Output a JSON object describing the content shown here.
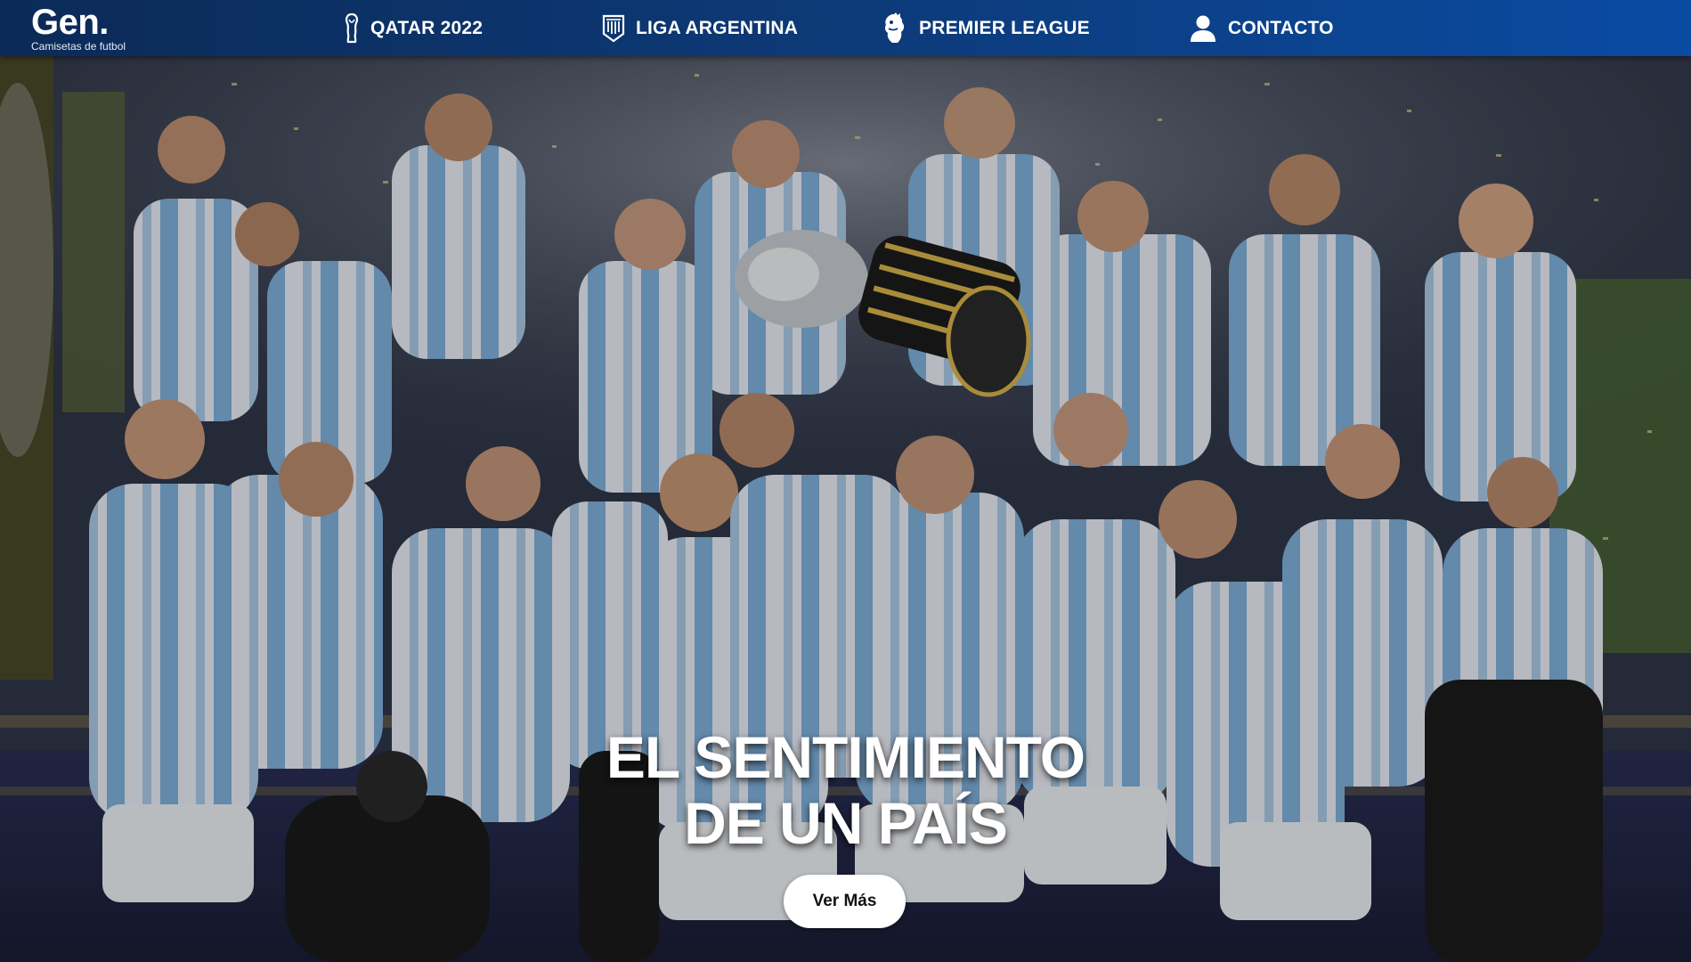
{
  "brand": {
    "name": "Gen.",
    "tagline": "Camisetas de futbol"
  },
  "nav": {
    "items": [
      {
        "label": "QATAR 2022",
        "icon": "world-cup-trophy-icon"
      },
      {
        "label": "LIGA ARGENTINA",
        "icon": "liga-argentina-crest-icon"
      },
      {
        "label": "PREMIER LEAGUE",
        "icon": "premier-league-lion-icon"
      },
      {
        "label": "CONTACTO",
        "icon": "user-icon"
      }
    ]
  },
  "hero": {
    "title_line1": "EL SENTIMIENTO",
    "title_line2": "DE UN PAÍS",
    "cta_label": "Ver Más",
    "image_description_icon": "team-celebration-photo"
  },
  "colors": {
    "nav_start": "#0b2a57",
    "nav_end": "#0a4ba3",
    "jersey_sky": "#75aadb",
    "jersey_white": "#f2f5f9"
  }
}
